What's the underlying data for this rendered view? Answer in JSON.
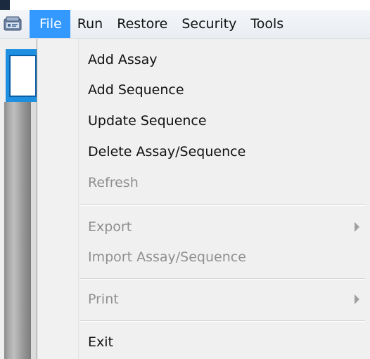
{
  "menubar": {
    "app_icon": "app-window-icon",
    "items": [
      {
        "label": "File",
        "active": true
      },
      {
        "label": "Run"
      },
      {
        "label": "Restore"
      },
      {
        "label": "Security"
      },
      {
        "label": "Tools"
      }
    ]
  },
  "file_menu": {
    "items": [
      {
        "label": "Add Assay",
        "enabled": true
      },
      {
        "label": "Add Sequence",
        "enabled": true
      },
      {
        "label": "Update Sequence",
        "enabled": true
      },
      {
        "label": "Delete Assay/Sequence",
        "enabled": true
      },
      {
        "label": "Refresh",
        "enabled": false
      },
      {
        "label": "Export",
        "enabled": false,
        "submenu": true
      },
      {
        "label": "Import Assay/Sequence",
        "enabled": false
      },
      {
        "label": "Print",
        "enabled": false,
        "submenu": true
      },
      {
        "label": "Exit",
        "enabled": true
      }
    ],
    "submenu_icon": "chevron-right-icon"
  },
  "colors": {
    "menu_highlight": "#3399ff",
    "disabled_text": "#8f8f8f",
    "background_window_accent": "#1f8fe0"
  }
}
